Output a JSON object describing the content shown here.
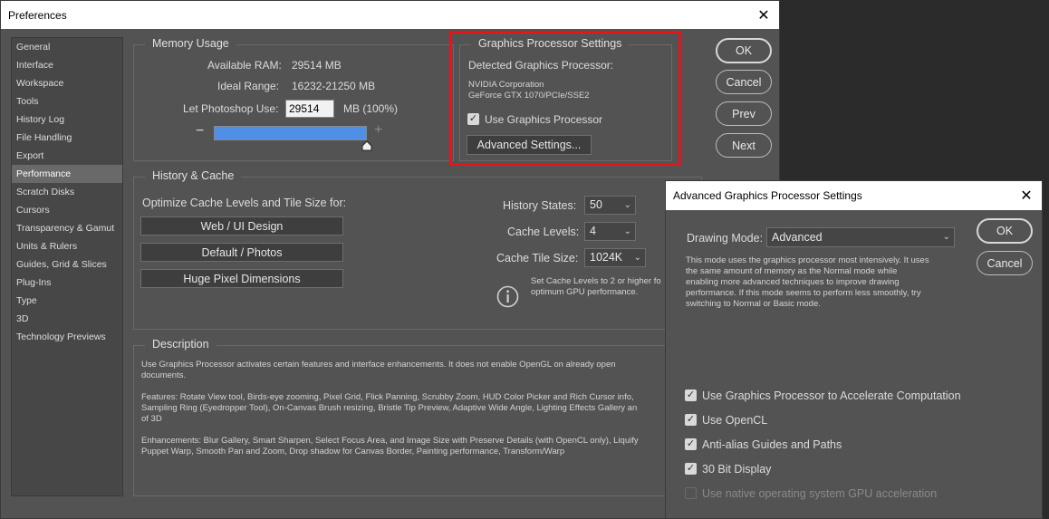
{
  "preferences": {
    "title": "Preferences",
    "close_glyph": "✕",
    "sidebar": [
      "General",
      "Interface",
      "Workspace",
      "Tools",
      "History Log",
      "File Handling",
      "Export",
      "Performance",
      "Scratch Disks",
      "Cursors",
      "Transparency & Gamut",
      "Units & Rulers",
      "Guides, Grid & Slices",
      "Plug-Ins",
      "Type",
      "3D",
      "Technology Previews"
    ],
    "active_sidebar": "Performance",
    "buttons": {
      "ok": "OK",
      "cancel": "Cancel",
      "prev": "Prev",
      "next": "Next"
    },
    "memory": {
      "legend": "Memory Usage",
      "available_label": "Available RAM:",
      "available_value": "29514 MB",
      "ideal_label": "Ideal Range:",
      "ideal_value": "16232-21250 MB",
      "let_label": "Let Photoshop Use:",
      "let_value": "29514",
      "let_suffix": "MB (100%)",
      "minus": "−",
      "plus": "+",
      "slider_fraction": 1.0
    },
    "gpu": {
      "legend": "Graphics Processor Settings",
      "detected_label": "Detected Graphics Processor:",
      "vendor": "NVIDIA Corporation",
      "model": "GeForce GTX 1070/PCIe/SSE2",
      "use_gpu_label": "Use Graphics Processor",
      "use_gpu_checked": true,
      "advanced_button": "Advanced Settings..."
    },
    "history": {
      "legend": "History & Cache",
      "optimize_label": "Optimize Cache Levels and Tile Size for:",
      "presets": [
        "Web / UI Design",
        "Default / Photos",
        "Huge Pixel Dimensions"
      ],
      "states_label": "History States:",
      "states_value": "50",
      "levels_label": "Cache Levels:",
      "levels_value": "4",
      "tile_label": "Cache Tile Size:",
      "tile_value": "1024K",
      "tip_line1": "Set Cache Levels to 2 or higher fo",
      "tip_line2": "optimum GPU performance."
    },
    "description": {
      "legend": "Description",
      "p1a": "Use Graphics Processor activates certain features and interface enhancements. It does not enable OpenGL on already open",
      "p1b": "documents.",
      "p2a": "Features: Rotate View tool, Birds-eye zooming, Pixel Grid, Flick Panning, Scrubby Zoom, HUD Color Picker and Rich Cursor info,",
      "p2b": "Sampling Ring (Eyedropper Tool), On-Canvas Brush resizing, Bristle Tip Preview, Adaptive Wide Angle, Lighting Effects Gallery an",
      "p2c": "of 3D",
      "p3a": "Enhancements: Blur Gallery, Smart Sharpen, Select Focus Area, and Image Size with Preserve Details (with OpenCL only), Liquify",
      "p3b": "Puppet Warp, Smooth Pan and Zoom, Drop shadow for Canvas Border, Painting performance, Transform/Warp"
    }
  },
  "advanced": {
    "title": "Advanced Graphics Processor Settings",
    "close_glyph": "✕",
    "drawing_mode_label": "Drawing Mode:",
    "drawing_mode_value": "Advanced",
    "desc": [
      "This mode uses the graphics processor most intensively.  It uses",
      "the same amount of memory as the Normal mode while",
      "enabling more advanced techniques to improve drawing",
      "performance.  If this mode seems to perform less smoothly, try",
      "switching to Normal or Basic mode."
    ],
    "ok": "OK",
    "cancel": "Cancel",
    "options": [
      {
        "label": "Use Graphics Processor to Accelerate Computation",
        "checked": true,
        "enabled": true
      },
      {
        "label": "Use OpenCL",
        "checked": true,
        "enabled": true
      },
      {
        "label": "Anti-alias Guides and Paths",
        "checked": true,
        "enabled": true
      },
      {
        "label": "30 Bit Display",
        "checked": true,
        "enabled": true
      },
      {
        "label": "Use native operating system GPU acceleration",
        "checked": false,
        "enabled": false
      }
    ]
  },
  "colors": {
    "highlight": "#e8141b",
    "slider": "#4f8fe6"
  }
}
